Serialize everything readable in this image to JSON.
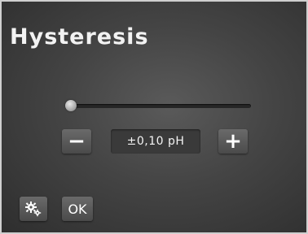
{
  "header": {
    "title": "Hysteresis"
  },
  "slider": {
    "level": 0.0
  },
  "stepper": {
    "decrease_icon": "minus-icon",
    "increase_icon": "plus-icon",
    "decrease_symbol": "−",
    "increase_symbol": "+",
    "value": "±0,10 pH"
  },
  "footer": {
    "settings_icon": "gear-icon",
    "ok_label": "OK"
  },
  "colors": {
    "background": "#444444",
    "button": "#5a5a5a",
    "text": "#f2f2f2"
  }
}
